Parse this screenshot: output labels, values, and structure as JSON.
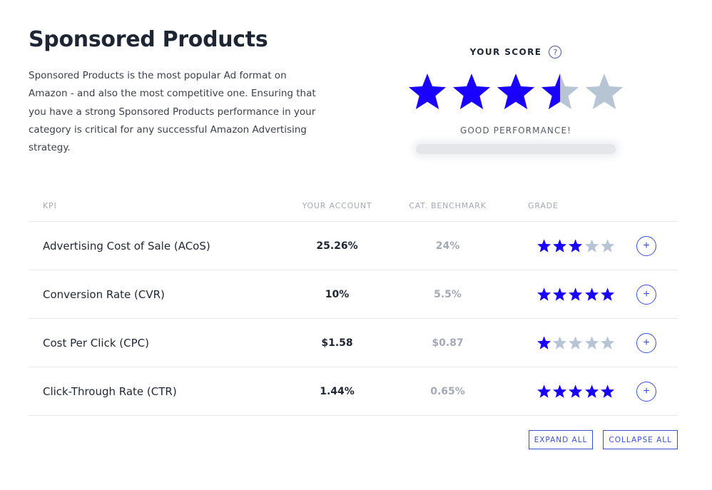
{
  "header": {
    "title": "Sponsored Products",
    "description": "Sponsored Products is the most popular Ad format on Amazon - and also the most competitive one. Ensuring that you have a strong Sponsored Products performance in your category is critical for any successful Amazon Advertising strategy."
  },
  "score": {
    "label": "YOUR SCORE",
    "help_icon": "?",
    "rating": 3.5,
    "max": 5,
    "performance_label": "GOOD PERFORMANCE!"
  },
  "colors": {
    "star_filled": "#1a00ff",
    "star_empty": "#b6c4d4",
    "accent": "#3b4fd6"
  },
  "table": {
    "headers": {
      "kpi": "KPI",
      "account": "YOUR ACCOUNT",
      "benchmark": "CAT. BENCHMARK",
      "grade": "GRADE"
    },
    "rows": [
      {
        "kpi": "Advertising Cost of Sale (ACoS)",
        "account": "25.26%",
        "benchmark": "24%",
        "grade": 3,
        "action": "+"
      },
      {
        "kpi": "Conversion Rate (CVR)",
        "account": "10%",
        "benchmark": "5.5%",
        "grade": 5,
        "action": "+"
      },
      {
        "kpi": "Cost Per Click (CPC)",
        "account": "$1.58",
        "benchmark": "$0.87",
        "grade": 1,
        "action": "+"
      },
      {
        "kpi": "Click-Through Rate (CTR)",
        "account": "1.44%",
        "benchmark": "0.65%",
        "grade": 5,
        "action": "+"
      }
    ]
  },
  "buttons": {
    "expand_all": "EXPAND ALL",
    "collapse_all": "COLLAPSE ALL"
  }
}
